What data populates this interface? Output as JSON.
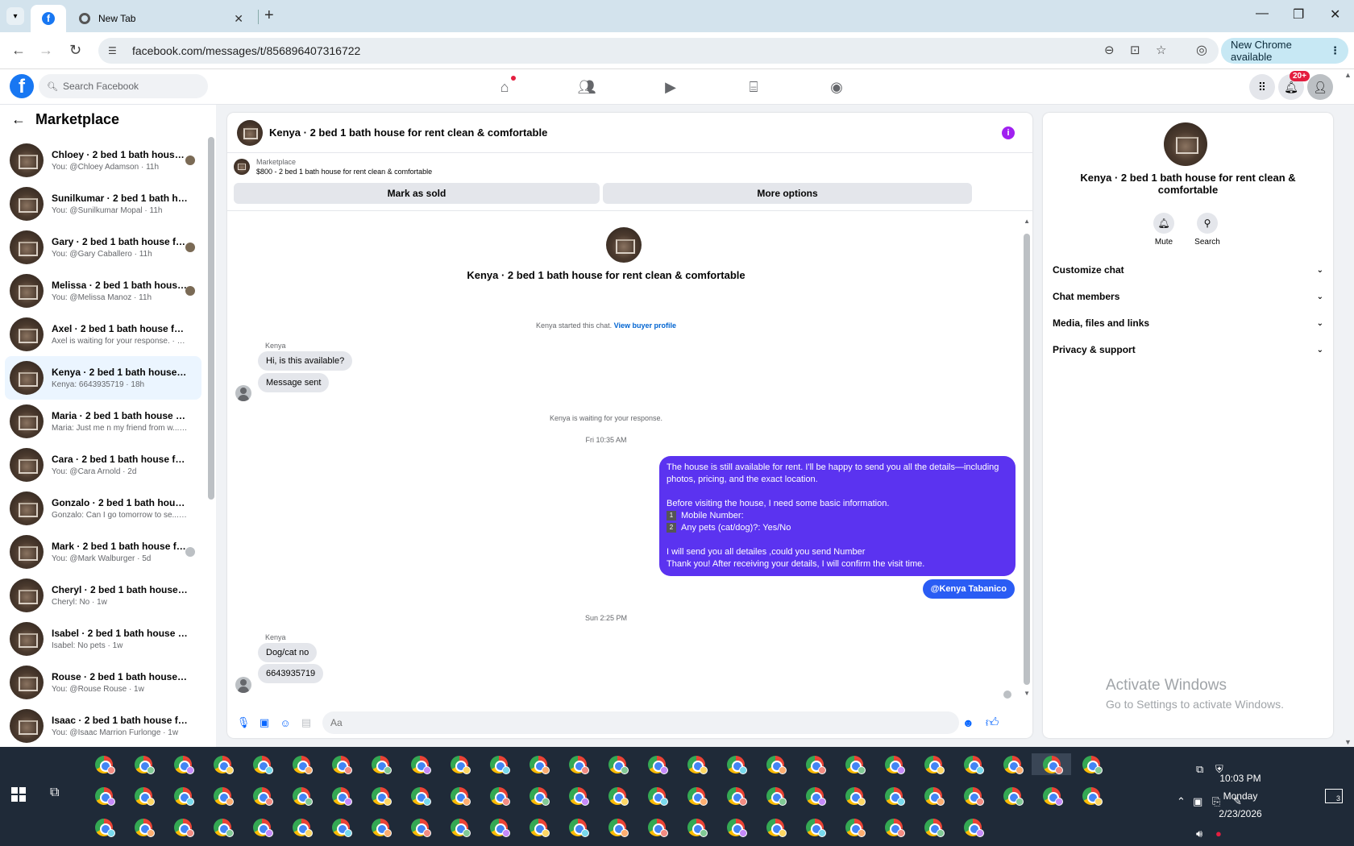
{
  "browser": {
    "active_tab_icon": "facebook-favicon",
    "new_tab_label": "New Tab",
    "url": "facebook.com/messages/t/856896407316722",
    "update_button": "New Chrome available"
  },
  "fb_nav": {
    "search_placeholder": "Search Facebook",
    "notification_badge": "20+"
  },
  "sidebar": {
    "title": "Marketplace",
    "conversations": [
      {
        "title": "Chloey · 2 bed 1 bath house f...",
        "sub": "You: @Chloey Adamson · 11h"
      },
      {
        "title": "Sunilkumar · 2 bed 1 bath hous...",
        "sub": "You: @Sunilkumar Mopal · 11h"
      },
      {
        "title": "Gary · 2 bed 1 bath house for...",
        "sub": "You: @Gary Caballero · 11h"
      },
      {
        "title": "Melissa · 2 bed 1 bath house ...",
        "sub": "You: @Melissa Manoz · 11h"
      },
      {
        "title": "Axel · 2 bed 1 bath house for re...",
        "sub": "Axel is waiting for your response. · 12h"
      },
      {
        "title": "Kenya · 2 bed 1 bath house for r...",
        "sub": "Kenya: 6643935719 · 18h"
      },
      {
        "title": "Maria · 2 bed 1 bath house for r...",
        "sub": "Maria: Just me n my friend from w... · 2d"
      },
      {
        "title": "Cara · 2 bed 1 bath house for re...",
        "sub": "You: @Cara Arnold · 2d"
      },
      {
        "title": "Gonzalo · 2 bed 1 bath house fo...",
        "sub": "Gonzalo: Can I go tomorrow to se... · 5d"
      },
      {
        "title": "Mark · 2 bed 1 bath house for...",
        "sub": "You: @Mark Walburger · 5d"
      },
      {
        "title": "Cheryl · 2 bed 1 bath house for ...",
        "sub": "Cheryl: No · 1w"
      },
      {
        "title": "Isabel · 2 bed 1 bath house for r...",
        "sub": "Isabel: No pets · 1w"
      },
      {
        "title": "Rouse · 2 bed 1 bath house for r...",
        "sub": "You: @Rouse Rouse · 1w"
      },
      {
        "title": "Isaac · 2 bed 1 bath house for re...",
        "sub": "You: @Isaac Marrion Furlonge · 1w"
      }
    ]
  },
  "chat": {
    "title": "Kenya · 2 bed 1 bath house for rent clean & comfortable",
    "listing_kicker": "Marketplace",
    "listing_line": "$800 - 2 bed 1 bath house for rent clean & comfortable",
    "mark_sold": "Mark as sold",
    "more_options": "More options",
    "intro_title": "Kenya · 2 bed 1 bath house for rent clean & comfortable",
    "started_note": "Kenya started this chat.",
    "view_profile": "View buyer profile",
    "sender_name": "Kenya",
    "msg1": "Hi, is this available?",
    "msg2": "Message sent",
    "waiting_note": "Kenya is waiting for your response.",
    "time1": "Fri 10:35 AM",
    "outgoing": {
      "line1": "The house is still available for rent. I'll be happy to send you all the details—including photos, pricing, and the exact location.",
      "line2": "Before visiting the house, I need some basic information.",
      "item1_num": "1",
      "item1": "Mobile Number:",
      "item2_num": "2",
      "item2": "Any pets (cat/dog)?: Yes/No",
      "line3": "I will send you all detailes ,could you send Number",
      "line4": "Thank you! After receiving your details, I will confirm the visit time."
    },
    "mention": "@Kenya Tabanico",
    "time2": "Sun 2:25 PM",
    "msg3": "Dog/cat no",
    "msg4": "6643935719",
    "input_placeholder": "Aa"
  },
  "info_panel": {
    "title": "Kenya · 2 bed 1 bath house for rent clean & comfortable",
    "mute": "Mute",
    "search": "Search",
    "rows": [
      "Customize chat",
      "Chat members",
      "Media, files and links",
      "Privacy & support"
    ]
  },
  "watermark": {
    "line1": "Activate Windows",
    "line2": "Go to Settings to activate Windows."
  },
  "taskbar": {
    "time": "10:03 PM",
    "day": "Monday",
    "date": "2/23/2026",
    "notifications": "3"
  }
}
